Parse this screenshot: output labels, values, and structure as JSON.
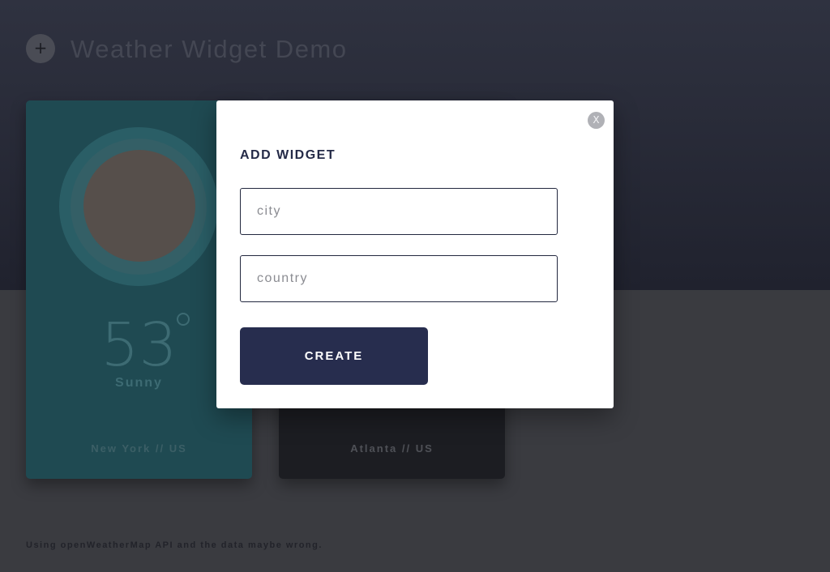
{
  "header": {
    "add_icon": "plus-icon",
    "add_label": "+",
    "title": "Weather Widget Demo"
  },
  "widgets": [
    {
      "temperature": "53",
      "condition": "Sunny",
      "location": "New York // US",
      "icon": "sun-icon"
    },
    {
      "location": "Atlanta // US"
    }
  ],
  "footer": {
    "note": "Using openWeatherMap API and the data maybe wrong."
  },
  "modal": {
    "close_label": "X",
    "title": "ADD WIDGET",
    "city_placeholder": "city",
    "city_value": "",
    "country_placeholder": "country",
    "country_value": "",
    "create_label": "CREATE"
  },
  "colors": {
    "accent": "#272d4e",
    "card_sunny": "#1f4a52",
    "card_dark": "#1c1d22"
  }
}
